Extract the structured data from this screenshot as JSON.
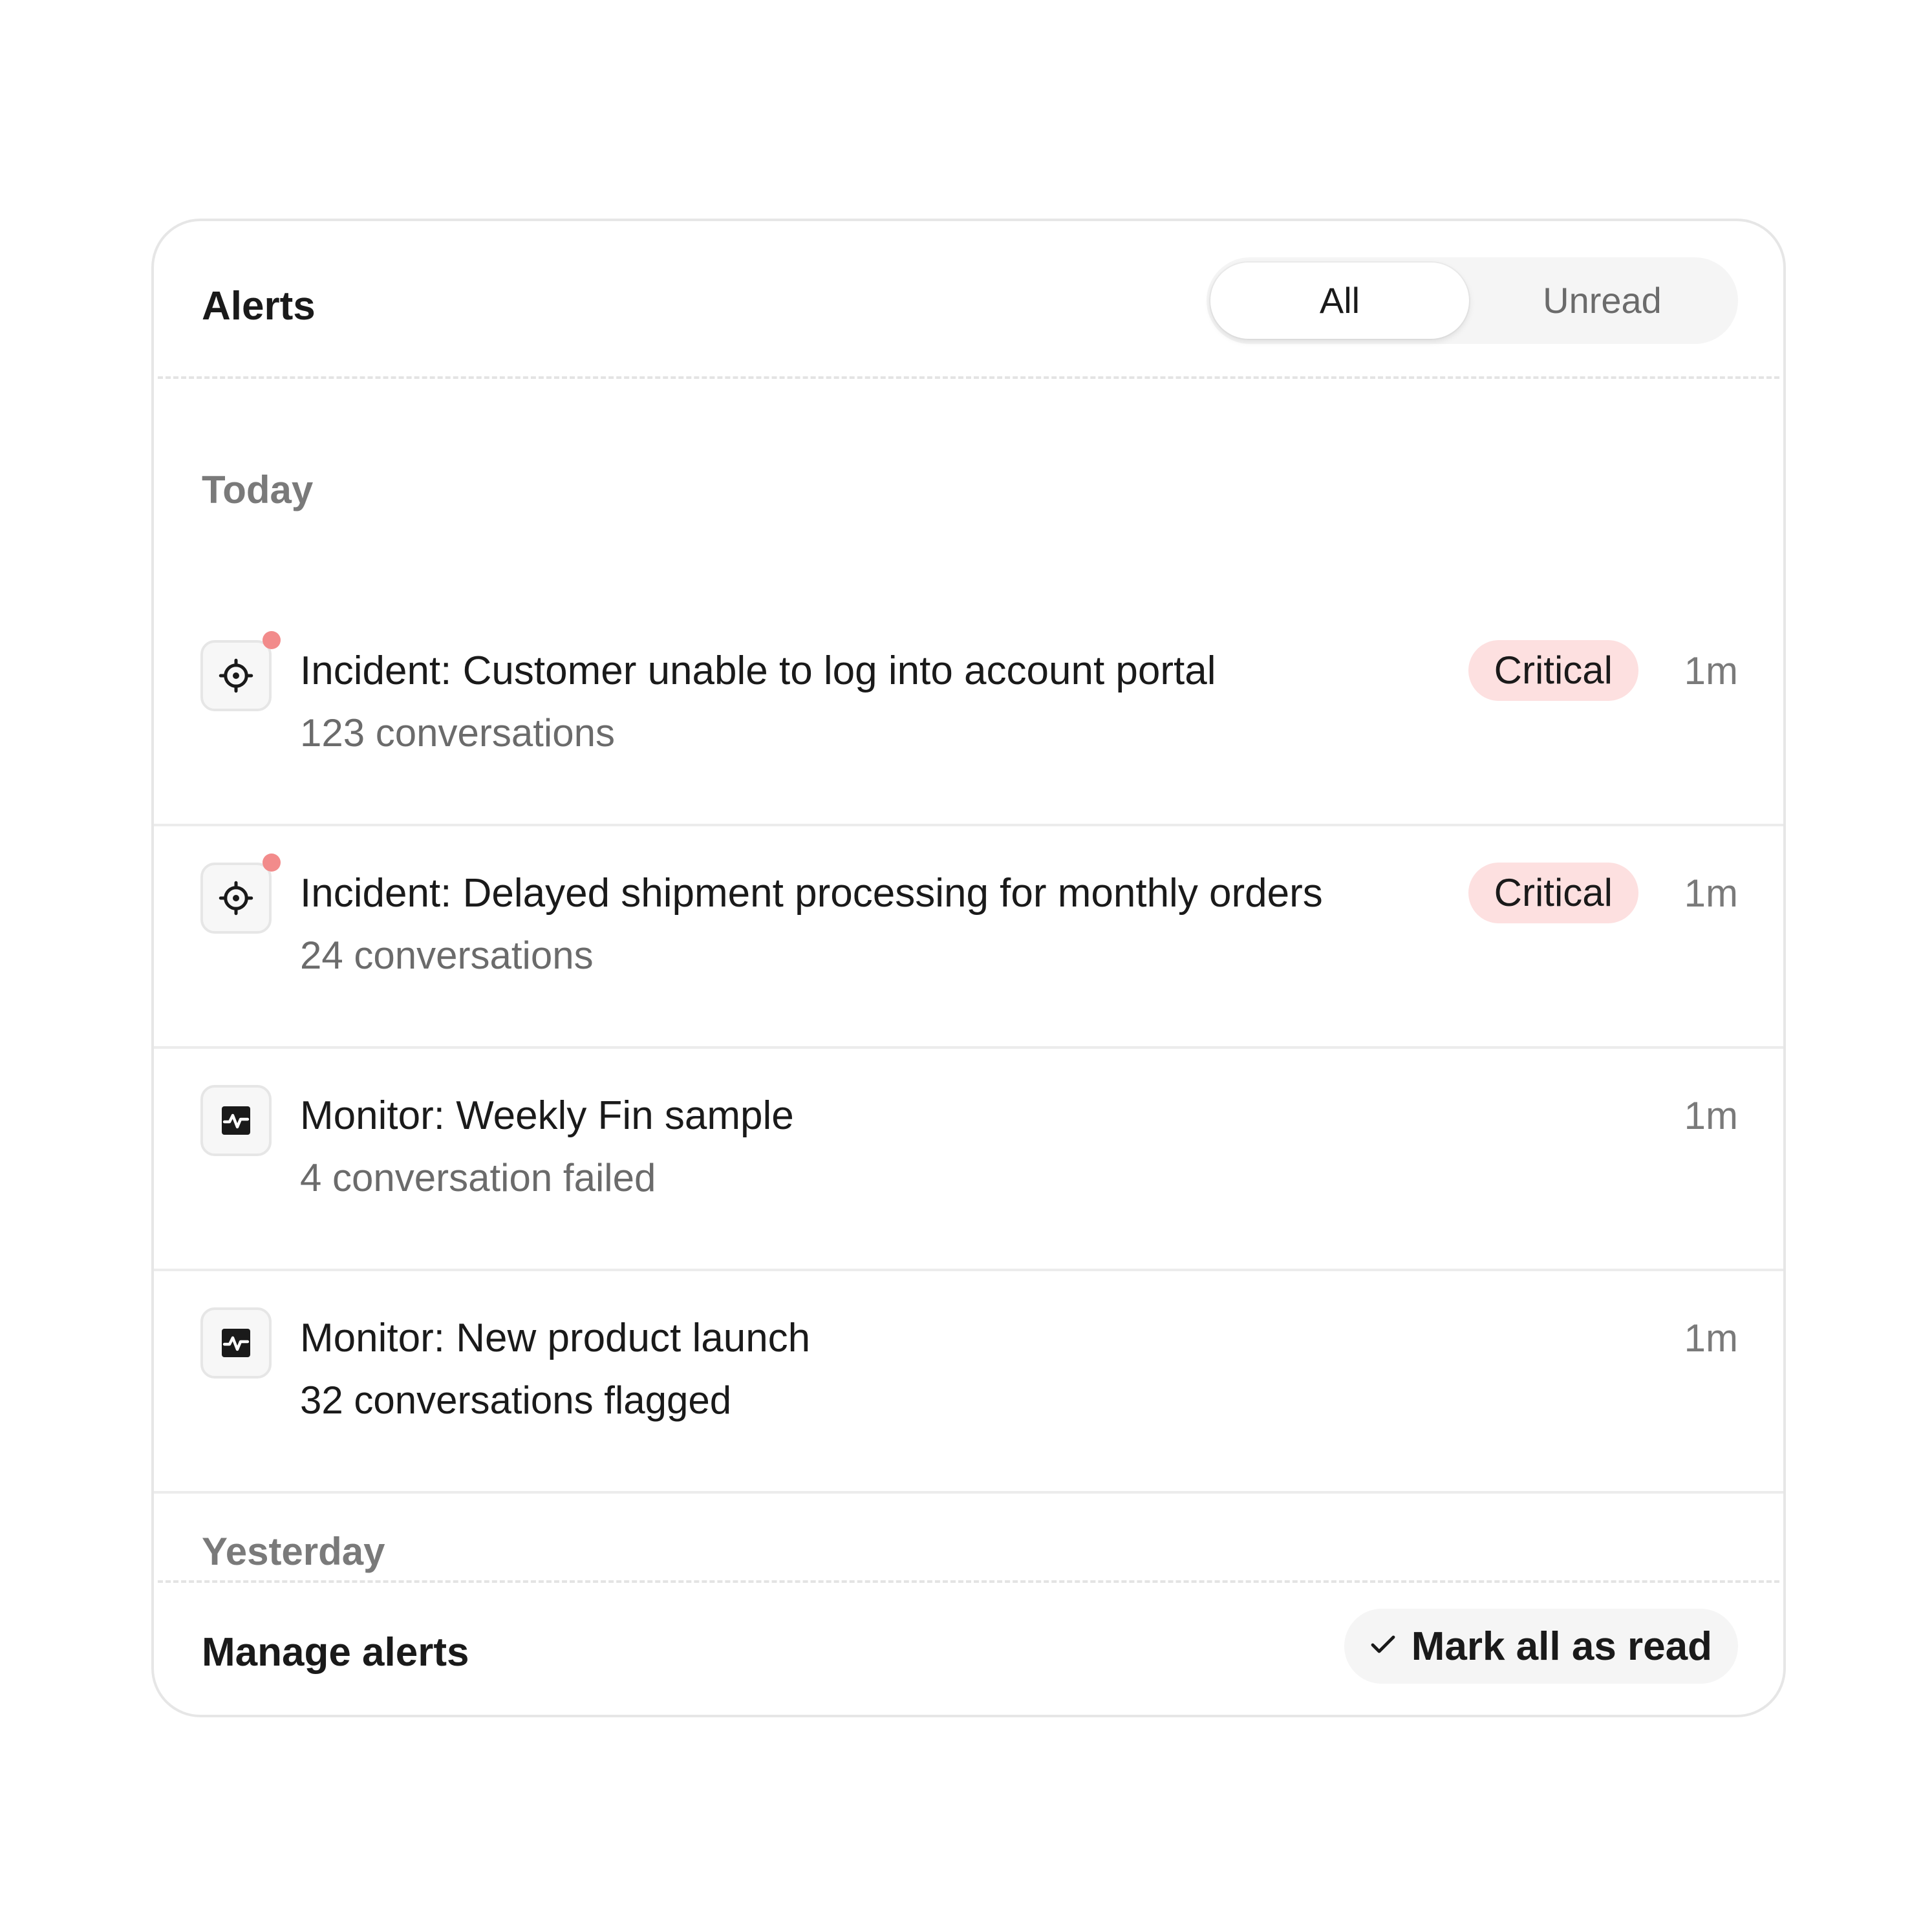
{
  "header": {
    "title": "Alerts",
    "filters": [
      {
        "label": "All",
        "selected": true
      },
      {
        "label": "Unread",
        "selected": false
      }
    ]
  },
  "sections": [
    {
      "label": "Today",
      "items": [
        {
          "icon": "target-icon",
          "unread": true,
          "title": "Incident: Customer unable to log into account portal",
          "subtitle": "123 conversations",
          "badge": "Critical",
          "time": "1m"
        },
        {
          "icon": "target-icon",
          "unread": true,
          "title": "Incident: Delayed shipment processing for monthly orders",
          "subtitle": "24 conversations",
          "badge": "Critical",
          "time": "1m"
        },
        {
          "icon": "monitor-pulse-icon",
          "unread": false,
          "title": "Monitor: Weekly Fin sample",
          "subtitle": "4 conversation failed",
          "time": "1m"
        },
        {
          "icon": "monitor-pulse-icon",
          "unread": false,
          "title": "Monitor: New product launch",
          "subtitle": "32 conversations flagged",
          "time": "1m"
        }
      ]
    },
    {
      "label": "Yesterday",
      "items": []
    }
  ],
  "footer": {
    "manage_label": "Manage alerts",
    "mark_all_label": "Mark all as read",
    "mark_all_icon": "check-icon"
  },
  "colors": {
    "badge_critical_bg": "#fde0e0",
    "unread_dot": "#f28b8b",
    "muted_text": "#6b6b6b"
  }
}
